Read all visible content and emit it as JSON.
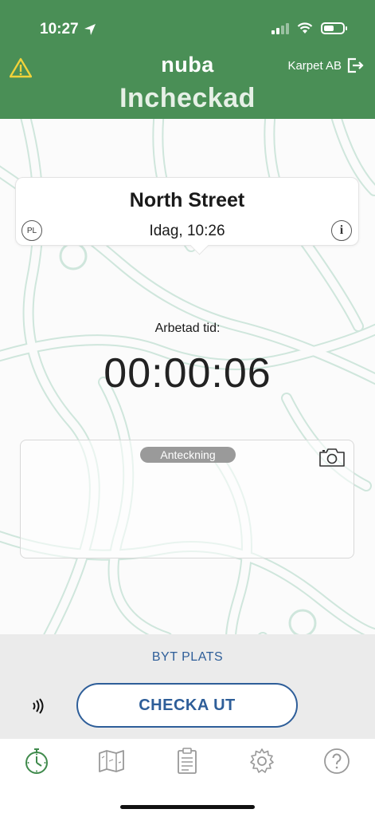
{
  "status_bar": {
    "time": "10:27",
    "battery_percent": 55
  },
  "header": {
    "logo": "nuba",
    "company": "Karpet AB",
    "title": "Incheckad",
    "bg_color": "#4a8f56",
    "warning_color": "#f0d23a"
  },
  "location": {
    "name": "North Street",
    "datetime": "Idag, 10:26",
    "badge": "PL"
  },
  "timer": {
    "label": "Arbetad tid:",
    "value": "00:00:06"
  },
  "note": {
    "label": "Anteckning"
  },
  "actions": {
    "switch_label": "BYT PLATS",
    "checkout_label": "CHECKA UT",
    "accent_color": "#2e5e99"
  },
  "tabs": [
    {
      "name": "timer-tab",
      "icon": "stopwatch-icon",
      "active": true
    },
    {
      "name": "map-tab",
      "icon": "map-icon",
      "active": false
    },
    {
      "name": "clipboard-tab",
      "icon": "clipboard-icon",
      "active": false
    },
    {
      "name": "settings-tab",
      "icon": "gear-icon",
      "active": false
    },
    {
      "name": "help-tab",
      "icon": "help-icon",
      "active": false
    }
  ]
}
